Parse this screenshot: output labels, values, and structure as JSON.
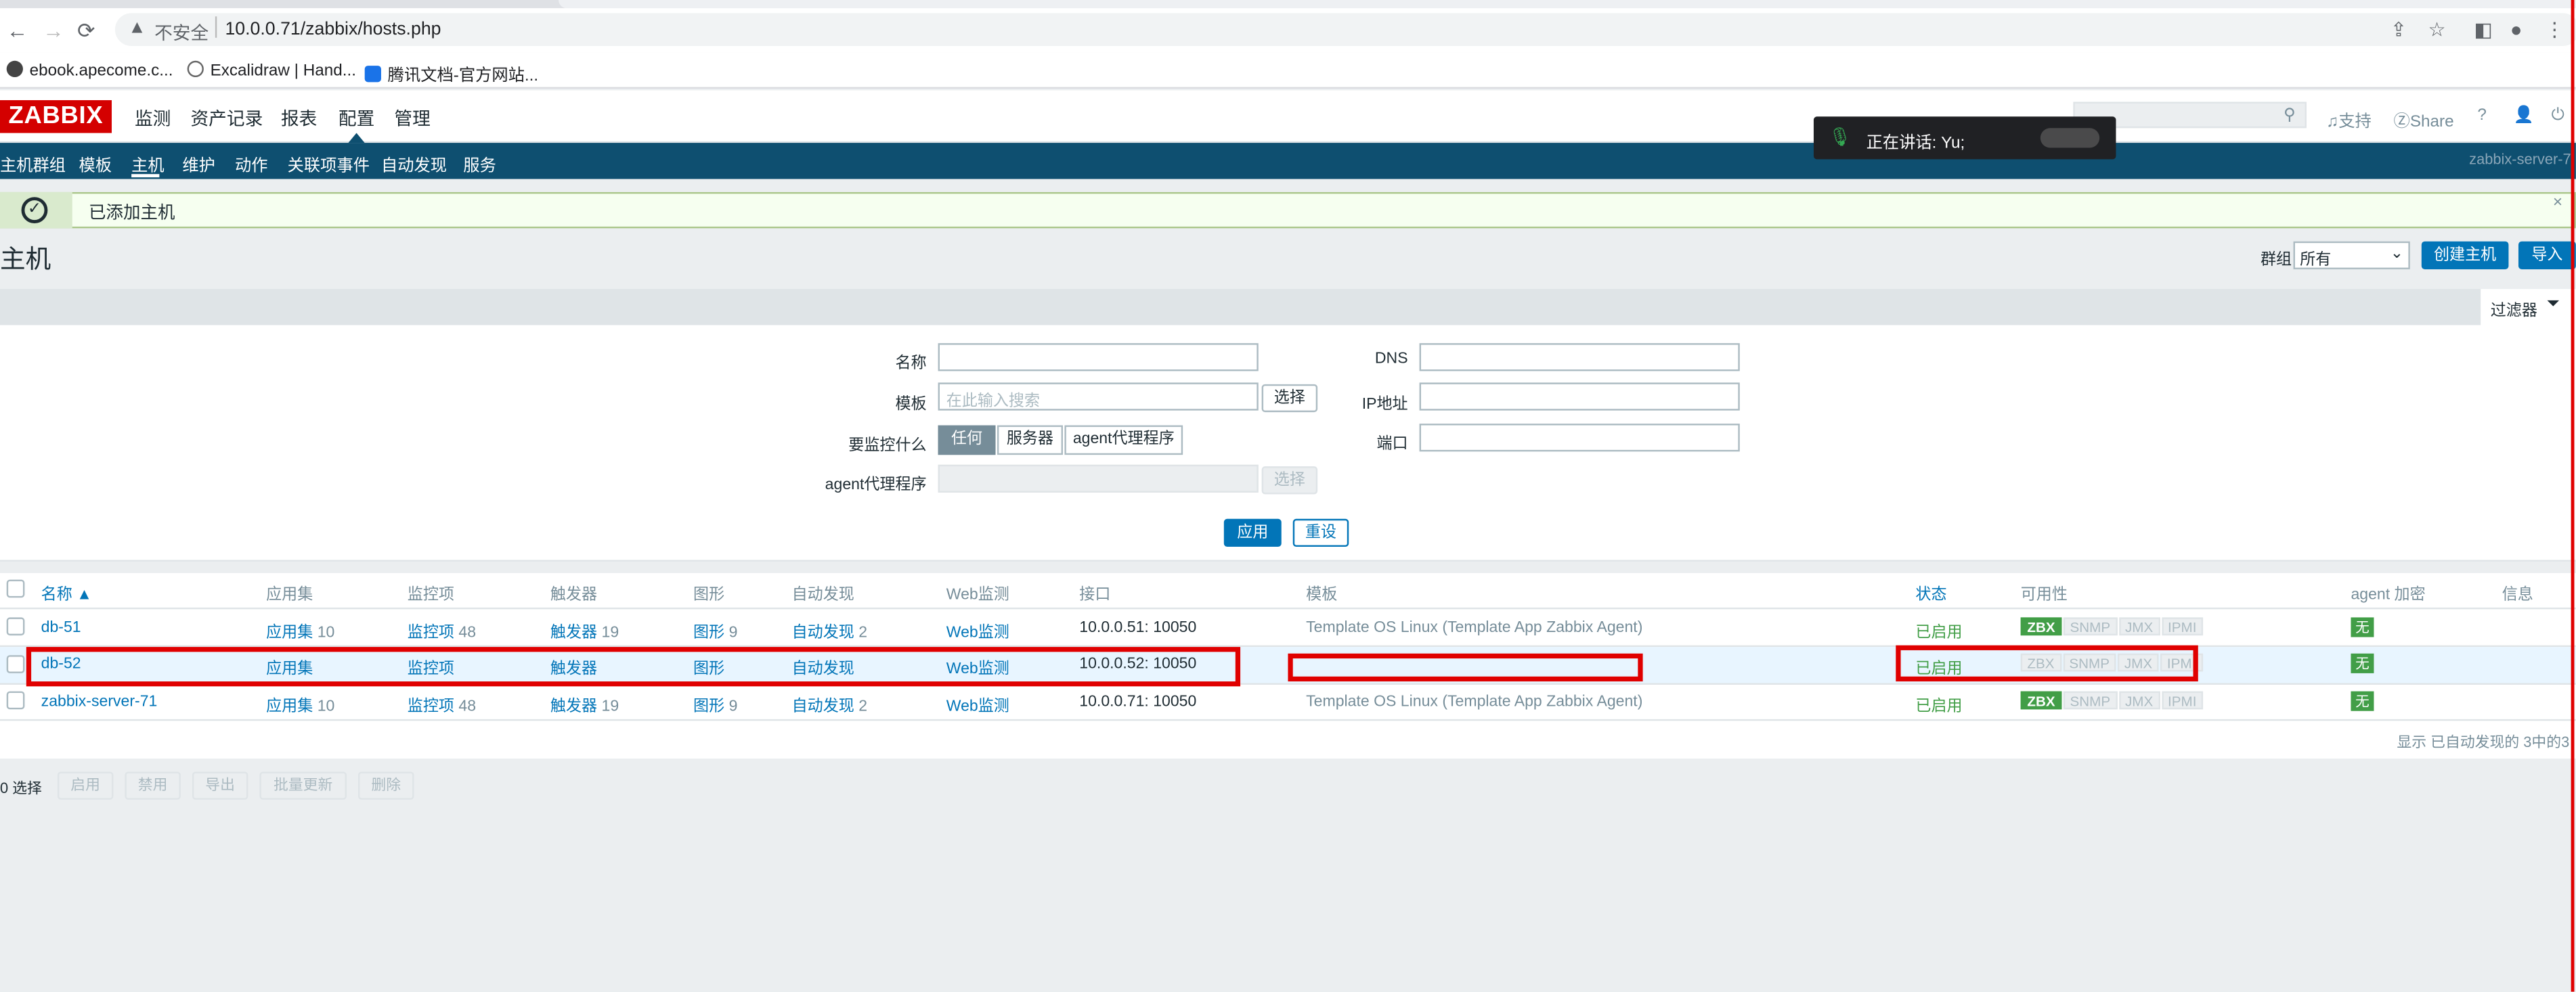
{
  "browser": {
    "nav": {
      "back": "←",
      "forward": "→",
      "reload": "⟳"
    },
    "url_insecure": "不安全",
    "url": "10.0.0.71/zabbix/hosts.php",
    "bookmarks": [
      "ebook.apecome.c...",
      "Excalidraw | Hand...",
      "腾讯文档-官方网站..."
    ]
  },
  "header": {
    "logo": "ZABBIX",
    "main_menu": [
      "监测",
      "资产记录",
      "报表",
      "配置",
      "管理"
    ],
    "support": "支持",
    "share": "Share",
    "help": "?",
    "sub_menu": [
      "主机群组",
      "模板",
      "主机",
      "维护",
      "动作",
      "关联项事件",
      "自动发现",
      "服务"
    ],
    "server_name": "zabbix-server-7"
  },
  "speaking": {
    "text": "正在讲话: Yu;"
  },
  "message": {
    "text": "已添加主机",
    "close": "×"
  },
  "page": {
    "title": "主机",
    "group_label": "群组",
    "group_value": "所有",
    "create_button": "创建主机",
    "import_button": "导入"
  },
  "filter": {
    "tab_label": "过滤器",
    "name_label": "名称",
    "template_label": "模板",
    "template_placeholder": "在此输入搜索",
    "select_label": "选择",
    "monitor_label": "要监控什么",
    "monitor_options": [
      "任何",
      "服务器",
      "agent代理程序"
    ],
    "proxy_label": "agent代理程序",
    "proxy_select": "选择",
    "dns_label": "DNS",
    "ip_label": "IP地址",
    "port_label": "端口",
    "apply": "应用",
    "reset": "重设"
  },
  "table": {
    "headers": [
      "名称 ▲",
      "应用集",
      "监控项",
      "触发器",
      "图形",
      "自动发现",
      "Web监测",
      "接口",
      "模板",
      "状态",
      "可用性",
      "agent 加密",
      "信息"
    ],
    "rows": [
      {
        "name": "db-51",
        "apps": "应用集",
        "apps_count": "10",
        "items": "监控项",
        "items_count": "48",
        "triggers": "触发器",
        "triggers_count": "19",
        "graphs": "图形",
        "graphs_count": "9",
        "discovery": "自动发现",
        "discovery_count": "2",
        "web": "Web监测",
        "interface": "10.0.0.51: 10050",
        "template": "Template OS Linux",
        "template_sub": "Template App Zabbix Agent",
        "status": "已启用",
        "zbx_active": true,
        "encryption": "无"
      },
      {
        "name": "db-52",
        "apps": "应用集",
        "apps_count": "",
        "items": "监控项",
        "items_count": "",
        "triggers": "触发器",
        "triggers_count": "",
        "graphs": "图形",
        "graphs_count": "",
        "discovery": "自动发现",
        "discovery_count": "",
        "web": "Web监测",
        "interface": "10.0.0.52: 10050",
        "template": "",
        "template_sub": "",
        "status": "已启用",
        "zbx_active": false,
        "encryption": "无"
      },
      {
        "name": "zabbix-server-71",
        "apps": "应用集",
        "apps_count": "10",
        "items": "监控项",
        "items_count": "48",
        "triggers": "触发器",
        "triggers_count": "19",
        "graphs": "图形",
        "graphs_count": "9",
        "discovery": "自动发现",
        "discovery_count": "2",
        "web": "Web监测",
        "interface": "10.0.0.71: 10050",
        "template": "Template OS Linux",
        "template_sub": "Template App Zabbix Agent",
        "status": "已启用",
        "zbx_active": true,
        "encryption": "无"
      }
    ],
    "availability_tags": [
      "ZBX",
      "SNMP",
      "JMX",
      "IPMI"
    ],
    "footer": "显示 已自动发现的 3中的3"
  },
  "bulk": {
    "selected": "0 选择",
    "buttons": [
      "启用",
      "禁用",
      "导出",
      "批量更新",
      "删除"
    ]
  },
  "colors": {
    "zabbix_red": "#d40000",
    "nav_blue": "#0e4f70",
    "link": "#0275b8",
    "enabled_green": "#429e47",
    "highlight_red": "#e00000"
  }
}
